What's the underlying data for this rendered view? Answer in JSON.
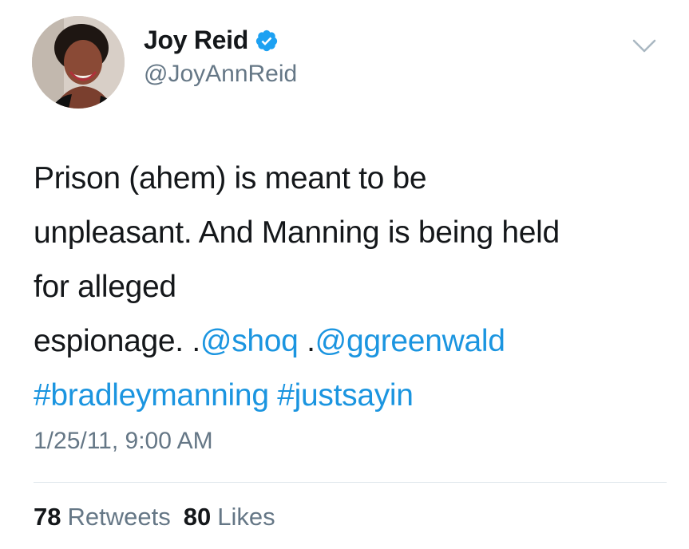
{
  "author": {
    "display_name": "Joy Reid",
    "handle": "@JoyAnnReid",
    "verified": true
  },
  "tweet": {
    "text": {
      "line1": "Prison (ahem) is meant to be",
      "line2": "unpleasant. And Manning is being held",
      "line3": "for alleged",
      "line4_prefix": "espionage. .",
      "mention1": "@shoq",
      "line4_sep": " .",
      "mention2": "@ggreenwald",
      "hashtag1": "#bradleymanning",
      "line5_sep": " ",
      "hashtag2": "#justsayin"
    },
    "timestamp": "1/25/11, 9:00 AM"
  },
  "stats": {
    "retweets_count": "78",
    "retweets_label": "Retweets",
    "likes_count": "80",
    "likes_label": "Likes"
  },
  "colors": {
    "link": "#1b95e0",
    "secondary_text": "#657786",
    "primary_text": "#14171a",
    "verified_badge": "#1da1f2",
    "divider": "#e1e8ed"
  },
  "icons": {
    "menu": "chevron-down-icon",
    "verified": "verified-badge-icon"
  }
}
